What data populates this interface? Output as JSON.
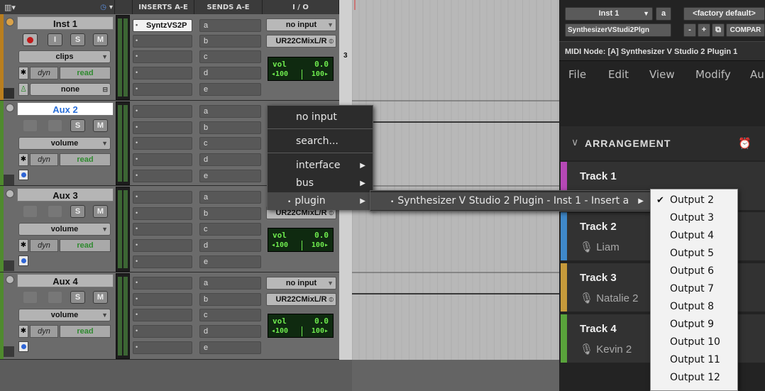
{
  "mix": {
    "headers": {
      "inserts": "INSERTS A-E",
      "sends": "SENDS A-E",
      "io": "I / O"
    },
    "tracks": [
      {
        "name": "Inst 1",
        "color": "#b97e1e",
        "view": "clips",
        "dyn": "dyn",
        "auto": "read",
        "group": "none",
        "inserts": [
          "SyntzVS2P",
          "",
          "",
          "",
          ""
        ],
        "sends": [
          "a",
          "b",
          "c",
          "d",
          "e"
        ],
        "input": "no input",
        "output": "UR22CMixL/R",
        "vol_label": "vol",
        "vol": "0.0",
        "pan_l": "◂100",
        "pan_r": "100▸"
      },
      {
        "name": "Aux 2",
        "color": "#4f8a2e",
        "view": "volume",
        "dyn": "dyn",
        "auto": "read",
        "inserts": [
          "",
          "",
          "",
          "",
          ""
        ],
        "sends": [
          "a",
          "b",
          "c",
          "d",
          "e"
        ]
      },
      {
        "name": "Aux 3",
        "color": "#4f8a2e",
        "view": "volume",
        "dyn": "dyn",
        "auto": "read",
        "inserts": [
          "",
          "",
          "",
          "",
          ""
        ],
        "sends": [
          "a",
          "b",
          "c",
          "d",
          "e"
        ],
        "output": "UR22CMixL/R",
        "vol_label": "vol",
        "vol": "0.0",
        "pan_l": "◂100",
        "pan_r": "100▸"
      },
      {
        "name": "Aux 4",
        "color": "#4f8a2e",
        "view": "volume",
        "dyn": "dyn",
        "auto": "read",
        "inserts": [
          "",
          "",
          "",
          "",
          ""
        ],
        "sends": [
          "a",
          "b",
          "c",
          "d",
          "e"
        ],
        "input": "no input",
        "output": "UR22CMixL/R",
        "vol_label": "vol",
        "vol": "0.0",
        "pan_l": "◂100",
        "pan_r": "100▸"
      }
    ],
    "buttons": {
      "solo": "S",
      "mute": "M",
      "input": "I"
    },
    "ruler_num": "3"
  },
  "plugin": {
    "track_select": "Inst 1",
    "insert_letter": "a",
    "preset": "<factory default>",
    "plugin_name": "SynthesizerVStudi2Plgn",
    "minus": "-",
    "plus": "+",
    "compare": "COMPAR",
    "midi_node": "MIDI Node: [A] Synthesizer V Studio 2 Plugin 1",
    "menu": [
      "File",
      "Edit",
      "View",
      "Modify",
      "Au"
    ],
    "arrangement": "ARRANGEMENT",
    "tracks": [
      {
        "name": "Track 1",
        "singer": "",
        "color": "#b548b5"
      },
      {
        "name": "Track 2",
        "singer": "Liam",
        "color": "#3f88c9"
      },
      {
        "name": "Track 3",
        "singer": "Natalie 2",
        "color": "#c59a3b"
      },
      {
        "name": "Track 4",
        "singer": "Kevin 2",
        "color": "#59a33b"
      }
    ]
  },
  "popup": {
    "items": [
      "no input",
      "search...",
      "interface",
      "bus",
      "plugin"
    ],
    "submenu": "Synthesizer V Studio 2 Plugin - Inst 1 - Insert a",
    "outputs": [
      "Output 2",
      "Output 3",
      "Output 4",
      "Output 5",
      "Output 6",
      "Output 7",
      "Output 8",
      "Output 9",
      "Output 10",
      "Output 11",
      "Output 12"
    ],
    "checked": "✔"
  }
}
